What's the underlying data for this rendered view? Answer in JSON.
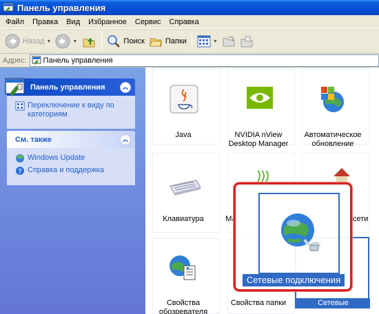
{
  "window": {
    "title": "Панель управления"
  },
  "menu": [
    "Файл",
    "Правка",
    "Вид",
    "Избранное",
    "Сервис",
    "Справка"
  ],
  "toolbar": {
    "back": "Назад",
    "search": "Поиск",
    "folders": "Папки"
  },
  "address": {
    "label": "Адрес:",
    "value": "Панель управления"
  },
  "sidebar": {
    "panel_title": "Панель управления",
    "switch_link": "Переключение к виду по категориям",
    "see_also_title": "См. также",
    "see_also": [
      "Windows Update",
      "Справка и поддержка"
    ]
  },
  "items": [
    "Java",
    "NVIDIA nView Desktop Manager",
    "Автоматическое обновление",
    "Клавиатура",
    "Ма",
    "сети",
    "Свойства обозревателя",
    "Свойства папки",
    "Сетевые подключения"
  ],
  "zoom": {
    "label": "Сетевые подключения"
  },
  "colors": {
    "title_bar": "#0a4fd2",
    "selection": "#316ac5",
    "highlight_frame": "#d62020",
    "sidebar": "#7ba2e7"
  }
}
